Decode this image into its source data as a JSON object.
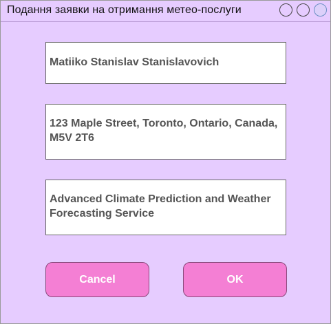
{
  "window": {
    "title": "Подання заявки на отримання метео-послуги",
    "controls": [
      "circle-button",
      "circle-button",
      "circle-button-active"
    ]
  },
  "form": {
    "name_value": "Matiiko Stanislav Stanislavovich",
    "address_value": "123 Maple Street, Toronto, Ontario, Canada, M5V 2T6",
    "service_value": "Advanced Climate Prediction and Weather Forecasting Service"
  },
  "actions": {
    "cancel_label": "Cancel",
    "ok_label": "OK"
  },
  "colors": {
    "background": "#e6ccff",
    "button": "#f47fd4",
    "field_text": "#555555"
  }
}
